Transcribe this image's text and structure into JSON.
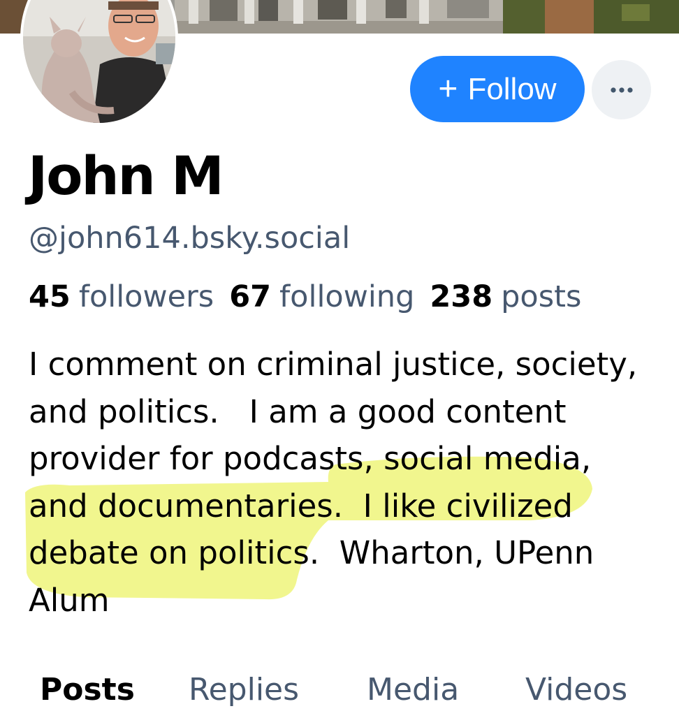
{
  "profile": {
    "display_name": "John M",
    "handle": "@john614.bsky.social",
    "stats": {
      "followers_count": "45",
      "followers_label": "followers",
      "following_count": "67",
      "following_label": "following",
      "posts_count": "238",
      "posts_label": "posts"
    },
    "bio_lines": [
      "I comment on criminal justice, society,",
      "and politics.   I am a good content",
      "provider for podcasts, social media,",
      "and documentaries.  I like civilized",
      "debate on politics.  Wharton, UPenn",
      "Alum"
    ],
    "highlight_color": "#eef47a"
  },
  "actions": {
    "follow_plus": "+",
    "follow_label": "Follow",
    "follow_color": "#1f83ff",
    "more_icon": "ellipsis-icon"
  },
  "tabs": [
    {
      "label": "Posts",
      "active": true
    },
    {
      "label": "Replies",
      "active": false
    },
    {
      "label": "Media",
      "active": false
    },
    {
      "label": "Videos",
      "active": false
    }
  ]
}
